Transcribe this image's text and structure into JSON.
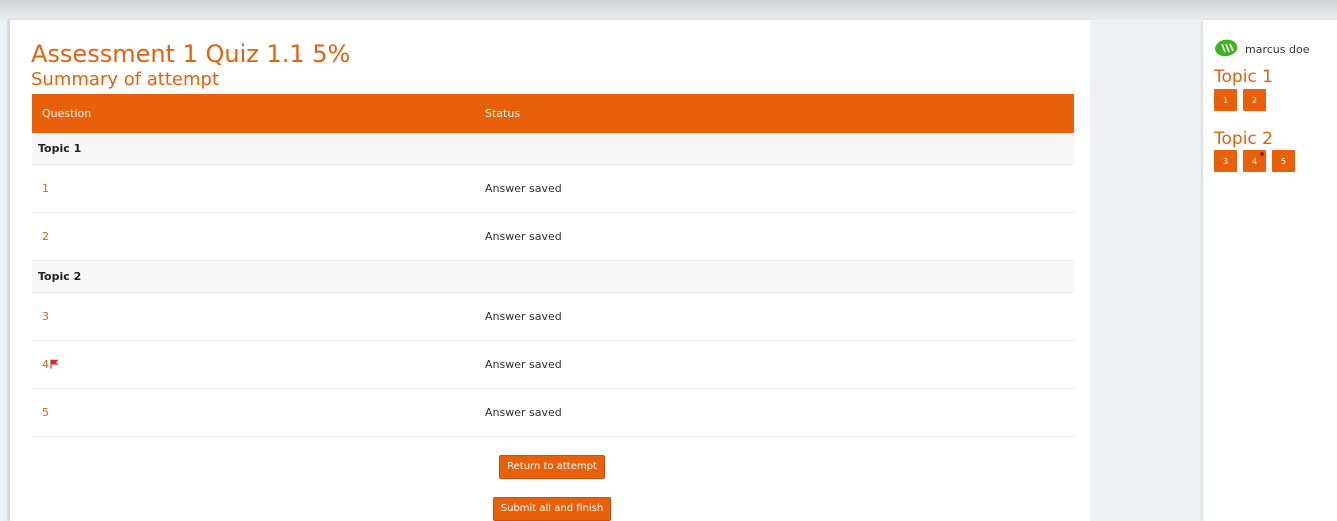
{
  "page": {
    "title": "Assessment 1 Quiz 1.1 5%",
    "subtitle": "Summary of attempt"
  },
  "table": {
    "headers": [
      "Question",
      "Status"
    ],
    "sections": [
      {
        "label": "Topic 1",
        "rows": [
          {
            "question": "1",
            "status": "Answer saved",
            "flagged": false
          },
          {
            "question": "2",
            "status": "Answer saved",
            "flagged": false
          }
        ]
      },
      {
        "label": "Topic 2",
        "rows": [
          {
            "question": "3",
            "status": "Answer saved",
            "flagged": false
          },
          {
            "question": "4",
            "status": "Answer saved",
            "flagged": true
          },
          {
            "question": "5",
            "status": "Answer saved",
            "flagged": false
          }
        ]
      }
    ]
  },
  "buttons": {
    "return": "Return to attempt",
    "submit": "Submit all and finish"
  },
  "sidebar": {
    "user_name": "marcus doe",
    "user_icon": "avatar-icon",
    "topics": [
      {
        "label": "Topic 1",
        "questions": [
          "1",
          "2"
        ]
      },
      {
        "label": "Topic 2",
        "questions": [
          "3",
          "4",
          "5"
        ]
      }
    ]
  },
  "colors": {
    "accent": "#e8600a",
    "flag": "#d32f2f",
    "avatar": "#3cb521"
  }
}
